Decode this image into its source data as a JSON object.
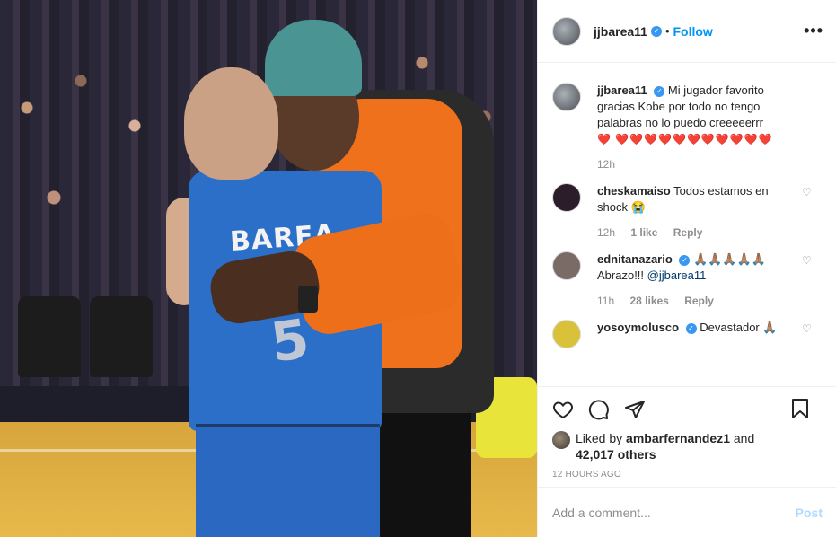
{
  "post": {
    "username": "jjbarea11",
    "verified": true,
    "follow_label": "Follow",
    "more_label": "•••",
    "photo": {
      "jersey_name": "BAREA",
      "jersey_number": "5"
    }
  },
  "caption": {
    "username": "jjbarea11",
    "text": "Mi jugador favorito gracias Kobe por todo no tengo palabras no lo puedo creeeeerrr",
    "hearts": "❤️ ❤️❤️❤️❤️❤️❤️❤️❤️❤️❤️❤️",
    "time": "12h"
  },
  "comments": [
    {
      "username": "cheskamaiso",
      "text": "Todos estamos en shock 😭",
      "time": "12h",
      "likes": "1 like",
      "reply": "Reply",
      "avatar_color": "#2b1d2a"
    },
    {
      "username": "ednitanazario",
      "verified": true,
      "emojis": "🙏🏽🙏🏽🙏🏽🙏🏽🙏🏽",
      "text": "Abrazo!!! ",
      "mention": "@jjbarea11",
      "time": "11h",
      "likes": "28 likes",
      "reply": "Reply",
      "avatar_color": "#7a6b66"
    },
    {
      "username": "yosoymolusco",
      "verified": true,
      "text": "Devastador 🙏🏽",
      "avatar_color": "#d9c23a"
    }
  ],
  "actions": {
    "liked_by_prefix": "Liked by ",
    "liked_by_user": "ambarfernandez1",
    "and": " and",
    "others": "42,017 others",
    "timestamp": "12 HOURS AGO"
  },
  "add_comment": {
    "placeholder": "Add a comment...",
    "post_label": "Post"
  },
  "colors": {
    "link": "#0095f6",
    "heart": "#ed4956",
    "muted": "#8e8e8e",
    "verified": "#3897f0"
  }
}
